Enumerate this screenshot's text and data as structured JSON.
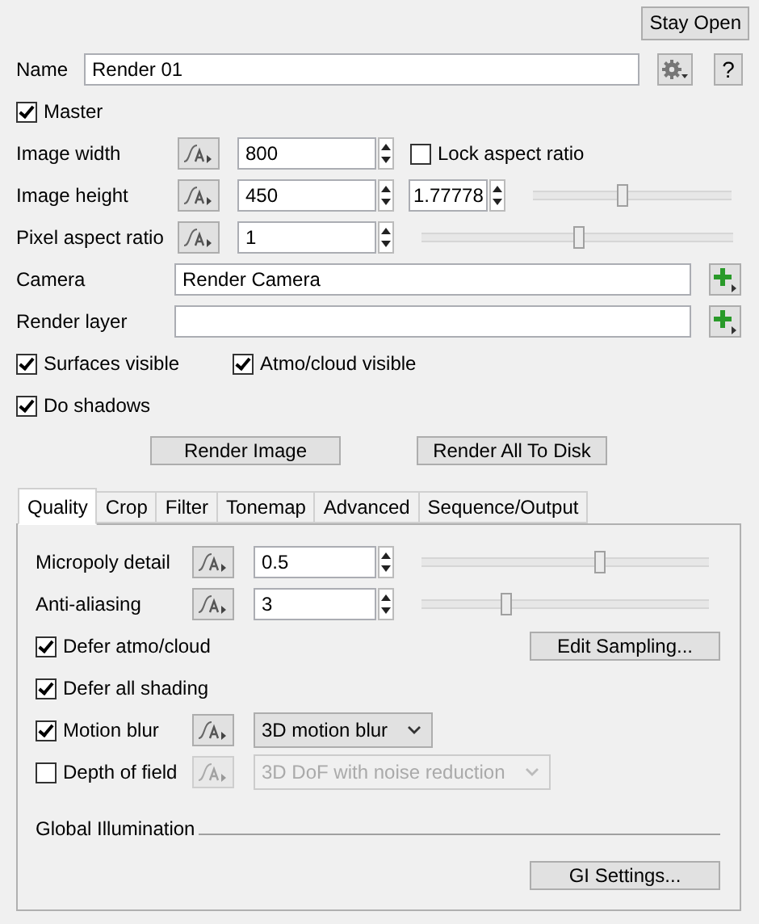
{
  "stay_open": "Stay Open",
  "name": {
    "label": "Name",
    "value": "Render 01"
  },
  "help": "?",
  "master": {
    "label": "Master",
    "checked": true
  },
  "image_width": {
    "label": "Image width",
    "value": "800"
  },
  "lock_aspect": {
    "label": "Lock aspect ratio",
    "checked": false
  },
  "image_height": {
    "label": "Image height",
    "value": "450",
    "ratio": "1.77778",
    "level": 0.45
  },
  "pixel_aspect": {
    "label": "Pixel aspect ratio",
    "value": "1",
    "level": 0.5
  },
  "camera": {
    "label": "Camera",
    "value": "Render Camera"
  },
  "render_layer": {
    "label": "Render layer"
  },
  "visibility": [
    {
      "label": "Surfaces visible",
      "checked": true
    },
    {
      "label": "Atmo/cloud visible",
      "checked": true
    }
  ],
  "do_shadows": {
    "label": "Do shadows",
    "checked": true
  },
  "buttons": [
    "Render Image",
    "Render All To Disk"
  ],
  "tabs": [
    {
      "label": "Quality",
      "selected": true
    },
    {
      "label": "Crop",
      "selected": false
    },
    {
      "label": "Filter",
      "selected": false
    },
    {
      "label": "Tonemap",
      "selected": false
    },
    {
      "label": "Advanced",
      "selected": false
    },
    {
      "label": "Sequence/Output",
      "selected": false
    }
  ],
  "quality": [
    {
      "kind": "slider",
      "label": "Micropoly detail",
      "value": "0.5",
      "level": 0.62
    },
    {
      "kind": "slider",
      "label": "Anti-aliasing",
      "value": "3",
      "level": 0.29
    },
    {
      "kind": "check_button",
      "label": "Defer atmo/cloud",
      "checked": true,
      "button": "Edit Sampling..."
    },
    {
      "kind": "check",
      "label": "Defer all shading",
      "checked": true
    },
    {
      "kind": "check_dropdown",
      "label": "Motion blur",
      "checked": true,
      "value": "3D motion blur",
      "disabled": false
    },
    {
      "kind": "check_dropdown",
      "label": "Depth of field",
      "checked": false,
      "value": "3D DoF with noise reduction",
      "disabled": true
    }
  ],
  "gi": {
    "title": "Global Illumination",
    "button": "GI Settings..."
  }
}
